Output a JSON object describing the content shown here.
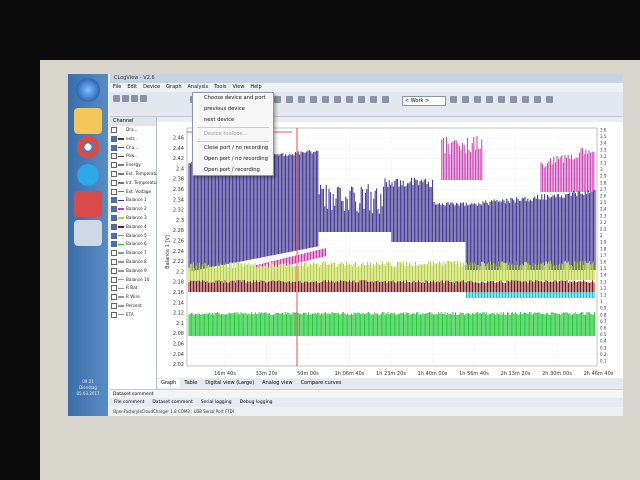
{
  "window": {
    "title": "CLogView - V2.6"
  },
  "menubar": [
    "File",
    "Edit",
    "Device",
    "Graph",
    "Analysis",
    "Tools",
    "View",
    "Help"
  ],
  "toolbar": {
    "work_dropdown": "< Work >"
  },
  "device_menu": [
    {
      "label": "Choose device and port",
      "enabled": true
    },
    {
      "label": "previous device",
      "enabled": true
    },
    {
      "label": "next device",
      "enabled": true
    },
    {
      "label": "Device toolbox...",
      "enabled": false
    },
    {
      "label": "Close port / no recording",
      "enabled": true
    },
    {
      "label": "Open port / no recording",
      "enabled": true
    },
    {
      "label": "Open port / recording",
      "enabled": true
    }
  ],
  "channel_panel": {
    "header": "Channel",
    "rows": [
      {
        "label": "Dra...",
        "checked": false,
        "color": ""
      },
      {
        "label": "extr...",
        "checked": true,
        "color": "#444444"
      },
      {
        "label": "Cha...",
        "checked": true,
        "color": "#6a3fa0"
      },
      {
        "label": "Pow...",
        "checked": false,
        "color": "#444444"
      },
      {
        "label": "Energy",
        "checked": false,
        "color": "#777777"
      },
      {
        "label": "Ext. Temperature",
        "checked": false,
        "color": "#777777"
      },
      {
        "label": "Int. Temperature",
        "checked": false,
        "color": "#777777"
      },
      {
        "label": "Ext. Voltage",
        "checked": false,
        "color": "#777777"
      },
      {
        "label": "Balance 1",
        "checked": true,
        "color": "#3a2d7c"
      },
      {
        "label": "Balance 2",
        "checked": true,
        "color": "#c93bb1"
      },
      {
        "label": "Balance 3",
        "checked": true,
        "color": "#b8d23b"
      },
      {
        "label": "Balance 4",
        "checked": true,
        "color": "#7a1a1a"
      },
      {
        "label": "Balance 5",
        "checked": true,
        "color": "#1fbfc9"
      },
      {
        "label": "Balance 6",
        "checked": true,
        "color": "#26c93b"
      },
      {
        "label": "Balance 7",
        "checked": false,
        "color": "#999999"
      },
      {
        "label": "Balance 8",
        "checked": false,
        "color": "#999999"
      },
      {
        "label": "Balance 9",
        "checked": false,
        "color": "#999999"
      },
      {
        "label": "Balance 10",
        "checked": false,
        "color": "#999999"
      },
      {
        "label": "R Bat",
        "checked": false,
        "color": "#999999"
      },
      {
        "label": "R Wire",
        "checked": false,
        "color": "#999999"
      },
      {
        "label": "Percent",
        "checked": false,
        "color": "#999999"
      },
      {
        "label": "ETA",
        "checked": false,
        "color": "#999999"
      }
    ]
  },
  "graph": {
    "y_axis_title": "Balance 1 [V]",
    "y_ticks": [
      "2.46",
      "2.44",
      "2.42",
      "2.4",
      "2.38",
      "2.36",
      "2.34",
      "2.32",
      "2.3",
      "2.28",
      "2.26",
      "2.24",
      "2.22",
      "2.2",
      "2.18",
      "2.16",
      "2.14",
      "2.12",
      "2.1",
      "2.08",
      "2.06",
      "2.04",
      "2.02"
    ],
    "x_ticks": [
      "16m 40s",
      "33m 20s",
      "50m 00s",
      "1h 06m 40s",
      "1h 23m 20s",
      "1h 40m 00s",
      "1h 56m 40s",
      "2h 13m 20s",
      "2h 30m 00s",
      "2h 46m 40s"
    ],
    "right_ticks": [
      "3.6",
      "3.5",
      "3.4",
      "3.3",
      "3.2",
      "3.1",
      "3",
      "2.9",
      "2.8",
      "2.7",
      "2.6",
      "2.5",
      "2.4",
      "2.3",
      "2.2",
      "2.1",
      "2",
      "1.9",
      "1.8",
      "1.7",
      "1.6",
      "1.5",
      "1.4",
      "1.3",
      "1.2",
      "1.1",
      "1",
      "0.9",
      "0.8",
      "0.7",
      "0.6",
      "0.5",
      "0.4",
      "0.3",
      "0.2",
      "0.1"
    ],
    "colors": {
      "purple": "#3a2d8c",
      "magenta": "#c93bb1",
      "yellow": "#b8d23b",
      "brown": "#7a1a1a",
      "cyan": "#1fbfc9",
      "green": "#26c93b",
      "red": "#e02020"
    }
  },
  "bottom_tabs": [
    "Graph",
    "Table",
    "Digital view (Large)",
    "Analog view",
    "Compare curves"
  ],
  "status": {
    "line1": "Dataset comment",
    "tabs": [
      "File comment",
      "Dataset comment",
      "Serial logging",
      "Debug logging"
    ],
    "line3": "OpenFactoryIsCloudCharger  1.8          COM3  : USB Serial Port  FTDI"
  },
  "tray": {
    "time": "09:21",
    "day": "Dienstag",
    "date": "05.03.2017"
  }
}
